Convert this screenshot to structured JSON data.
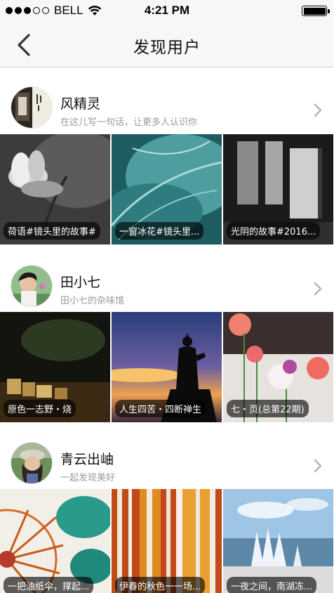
{
  "status_bar": {
    "carrier": "BELL",
    "time": "4:21 PM"
  },
  "nav": {
    "title": "发现用户"
  },
  "users": [
    {
      "name": "风精灵",
      "subtitle": "在这儿写一句话，让更多人认识你",
      "photos": [
        {
          "caption": "荷语#镜头里的故事#"
        },
        {
          "caption": "一窗冰花#镜头里..."
        },
        {
          "caption": "光阴的故事#2016..."
        }
      ]
    },
    {
      "name": "田小七",
      "subtitle": "田小七的杂味馆",
      "photos": [
        {
          "caption": "原色一志野・烧"
        },
        {
          "caption": "人生四苦・四断禅生"
        },
        {
          "caption": "七・页(总第22期)"
        }
      ]
    },
    {
      "name": "青云出岫",
      "subtitle": "一起发现美好",
      "photos": [
        {
          "caption": "一把油纸伞，撑起..."
        },
        {
          "caption": "伊春的秋色一一场..."
        },
        {
          "caption": "一夜之间，南湖冻..."
        }
      ]
    }
  ]
}
